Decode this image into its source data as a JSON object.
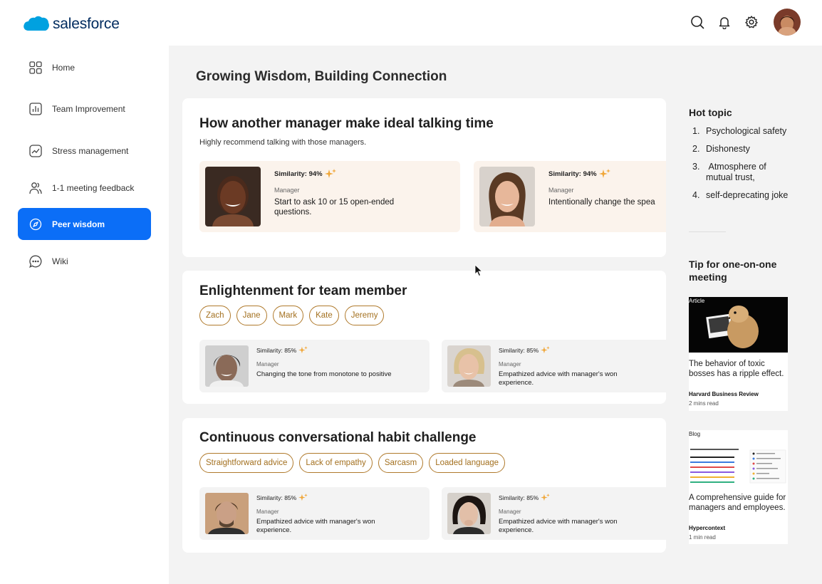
{
  "brand": {
    "name": "salesforce",
    "color": "#00a1e0"
  },
  "header": {
    "icons": [
      "search-icon",
      "bell-icon",
      "gear-icon"
    ],
    "avatar": "user-avatar"
  },
  "sidebar": {
    "items": [
      {
        "label": "Home",
        "icon": "grid-icon",
        "active": false
      },
      {
        "label": "Team Improvement",
        "icon": "bar-chart-icon",
        "active": false
      },
      {
        "label": "Stress management",
        "icon": "trend-icon",
        "active": false
      },
      {
        "label": "1-1 meeting feedback",
        "icon": "people-icon",
        "active": false
      },
      {
        "label": "Peer wisdom",
        "icon": "compass-icon",
        "active": true
      },
      {
        "label": "Wiki",
        "icon": "chat-icon",
        "active": false
      }
    ],
    "active_color": "#0b6ef7"
  },
  "main": {
    "title": "Growing Wisdom, Building Connection",
    "section1": {
      "title": "How another manager make ideal talking time",
      "subtitle": "Highly recommend talking with those managers.",
      "cards": [
        {
          "similarity": "Similarity: 94%",
          "role": "Manager",
          "text": "Start to ask 10 or 15 open-ended\nquestions."
        },
        {
          "similarity": "Similarity: 94%",
          "role": "Manager",
          "text": "Intentionally change the spea"
        }
      ]
    },
    "section2": {
      "title": "Enlightenment for team member",
      "chips": [
        "Zach",
        "Jane",
        "Mark",
        "Kate",
        "Jeremy"
      ],
      "cards": [
        {
          "similarity": "Similarity: 85%",
          "role": "Manager",
          "text": "Changing the tone from monotone to positive"
        },
        {
          "similarity": "Similarity: 85%",
          "role": "Manager",
          "text": "Empathized advice with manager's won experience."
        }
      ]
    },
    "section3": {
      "title": "Continuous conversational habit challenge",
      "chips": [
        "Straightforward advice",
        "Lack of empathy",
        "Sarcasm",
        "Loaded language"
      ],
      "cards": [
        {
          "similarity": "Similarity: 85%",
          "role": "Manager",
          "text": "Empathized advice with manager's won experience."
        },
        {
          "similarity": "Similarity: 85%",
          "role": "Manager",
          "text": "Empathized advice with manager's won experience."
        }
      ]
    },
    "chip_color": "#a3701f"
  },
  "right": {
    "hot_topic_title": "Hot topic",
    "hot_topics": [
      {
        "num": "1.",
        "text": "Psychological safety"
      },
      {
        "num": "2.",
        "text": "Dishonesty"
      },
      {
        "num": "3.",
        "text": " Atmosphere of mutual trust,"
      },
      {
        "num": "4.",
        "text": "self-deprecating joke"
      }
    ],
    "tip_title": "Tip for one-on-one meeting",
    "articles": [
      {
        "tag": "Article",
        "title": "The behavior of toxic bosses has a ripple effect.",
        "source": "Harvard Business Review",
        "read": "2 mins read"
      },
      {
        "tag": "Blog",
        "title": "A comprehensive guide for managers and employees.",
        "source": "Hypercontext",
        "read": "1 min read"
      }
    ]
  }
}
